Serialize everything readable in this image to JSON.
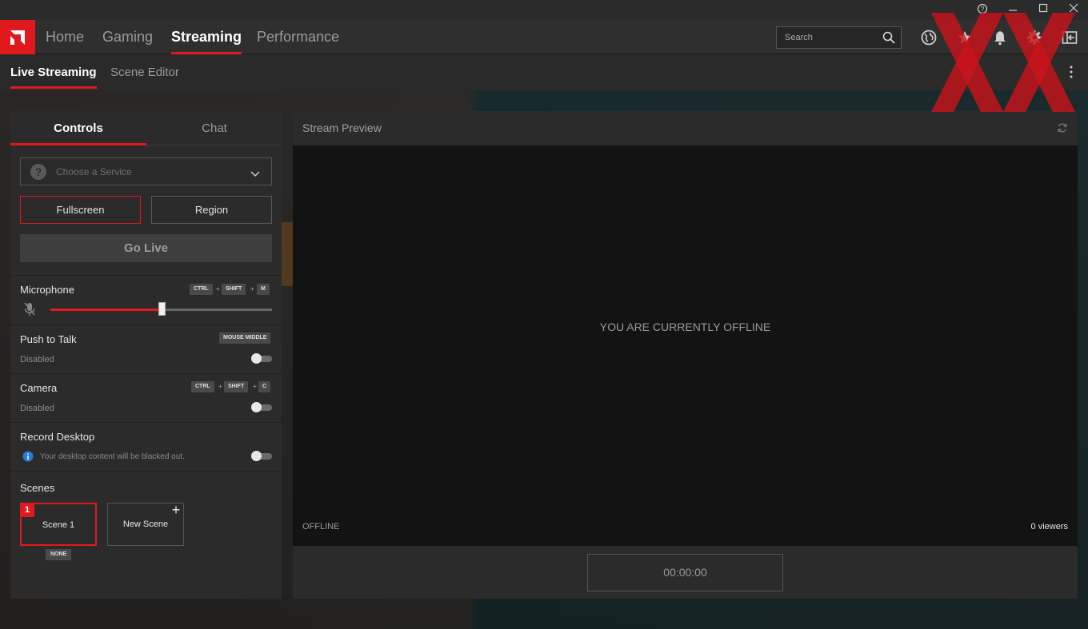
{
  "window": {
    "controls": {
      "help": "?",
      "minimize": "—",
      "maximize": "☐",
      "close": "✕"
    }
  },
  "topnav": {
    "items": [
      "Home",
      "Gaming",
      "Streaming",
      "Performance"
    ],
    "active": "Streaming",
    "search_placeholder": "Search",
    "icons": [
      "globe-icon",
      "star-icon",
      "bell-icon",
      "gear-icon",
      "sign-out-icon"
    ]
  },
  "subnav": {
    "items": [
      "Live Streaming",
      "Scene Editor"
    ],
    "active": "Live Streaming"
  },
  "controls_panel": {
    "tabs": [
      "Controls",
      "Chat"
    ],
    "active_tab": "Controls",
    "service_placeholder": "Choose a Service",
    "capture_buttons": [
      "Fullscreen",
      "Region"
    ],
    "selected_capture": "Fullscreen",
    "go_live": "Go Live",
    "microphone": {
      "title": "Microphone",
      "shortcut": [
        "CTRL",
        "SHIFT",
        "M"
      ],
      "level": 0.5
    },
    "push_to_talk": {
      "title": "Push to Talk",
      "shortcut": [
        "MOUSE MIDDLE"
      ],
      "status": "Disabled",
      "enabled": false
    },
    "camera": {
      "title": "Camera",
      "shortcut": [
        "CTRL",
        "SHIFT",
        "C"
      ],
      "status": "Disabled",
      "enabled": false
    },
    "record_desktop": {
      "title": "Record Desktop",
      "note": "Your desktop content will be blacked out.",
      "enabled": false
    },
    "scenes": {
      "title": "Scenes",
      "items": [
        {
          "number": "1",
          "label": "Scene 1",
          "badge": "NONE",
          "selected": true
        },
        {
          "label": "New Scene",
          "add": "+"
        }
      ]
    },
    "key_plus": "+"
  },
  "preview_panel": {
    "title": "Stream Preview",
    "message": "YOU ARE CURRENTLY OFFLINE",
    "status": "OFFLINE",
    "viewers": "0 viewers",
    "timer": "00:00:00"
  },
  "colors": {
    "accent": "#e0191e",
    "panel": "#2b2b2b",
    "preview_bg": "#131313"
  }
}
